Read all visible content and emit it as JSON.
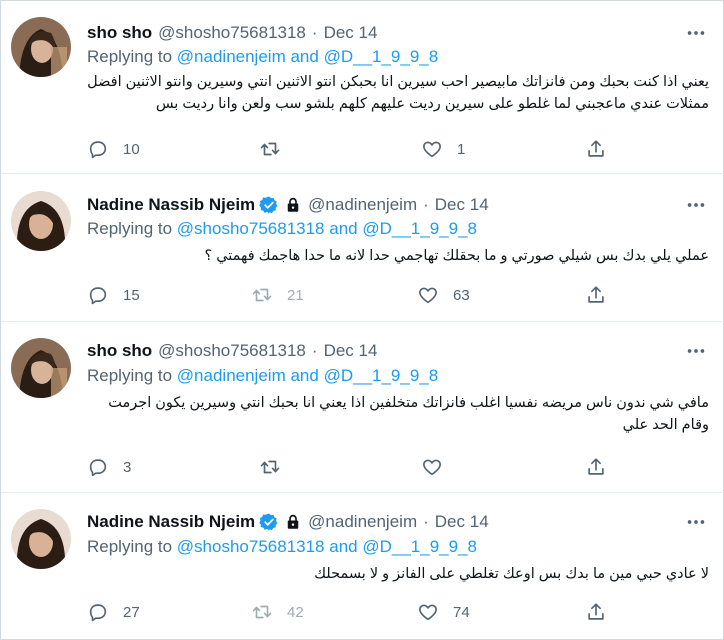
{
  "tweets": [
    {
      "display_name": "sho sho",
      "handle": "@shosho75681318",
      "separator": "·",
      "date": "Dec 14",
      "replying_prefix": "Replying to",
      "reply_user1": "@nadinenjeim",
      "reply_and": "and",
      "reply_user2": "@D__1_9_9_8",
      "text": "يعني اذا كنت بحبك ومن فانزاتك مابيصير احب سيرين انا بحبكن انتو الاثنين انتي وسيرين وانتو الاثنين افضل ممثلات عندي ماعجبني لما غلطو على سيرين رديت عليهم  كلهم بلشو سب ولعن وانا رديت بس",
      "replies": "10",
      "retweets": "",
      "likes": "1"
    },
    {
      "display_name": "Nadine Nassib Njeim",
      "handle": "@nadinenjeim",
      "separator": "·",
      "date": "Dec 14",
      "replying_prefix": "Replying to",
      "reply_user1": "@shosho75681318",
      "reply_and": "and",
      "reply_user2": "@D__1_9_9_8",
      "text": "عملي يلي بدك بس شيلي صورتي و ما بحقلك تهاجمي حدا لانه ما حدا هاجمك فهمتي ؟",
      "replies": "15",
      "retweets": "21",
      "likes": "63"
    },
    {
      "display_name": "sho sho",
      "handle": "@shosho75681318",
      "separator": "·",
      "date": "Dec 14",
      "replying_prefix": "Replying to",
      "reply_user1": "@nadinenjeim",
      "reply_and": "and",
      "reply_user2": "@D__1_9_9_8",
      "text": "مافي شي ندون ناس مريضه  نفسيا اغلب فانزاتك متخلفين اذا يعني انا بحبك انتي وسيرين يكون اجرمت وقام الحد علي",
      "replies": "3",
      "retweets": "",
      "likes": ""
    },
    {
      "display_name": "Nadine Nassib Njeim",
      "handle": "@nadinenjeim",
      "separator": "·",
      "date": "Dec 14",
      "replying_prefix": "Replying to",
      "reply_user1": "@shosho75681318",
      "reply_and": "and",
      "reply_user2": "@D__1_9_9_8",
      "text": "لا عادي حبي مين ما بدك بس اوعك تغلطي على الفانز و لا بسمحلك",
      "replies": "27",
      "retweets": "42",
      "likes": "74"
    }
  ],
  "icons": {
    "reply": "comment-bubble-icon",
    "retweet": "retweet-arrows-icon",
    "like": "heart-icon",
    "share": "share-upload-icon",
    "more": "more-dots-icon",
    "verified": "verified-badge-icon",
    "protected": "lock-icon"
  },
  "colors": {
    "link": "#1d9bf0",
    "secondary_text": "#536471",
    "verified": "#1d9bf0",
    "divider": "#e6ecf0"
  }
}
